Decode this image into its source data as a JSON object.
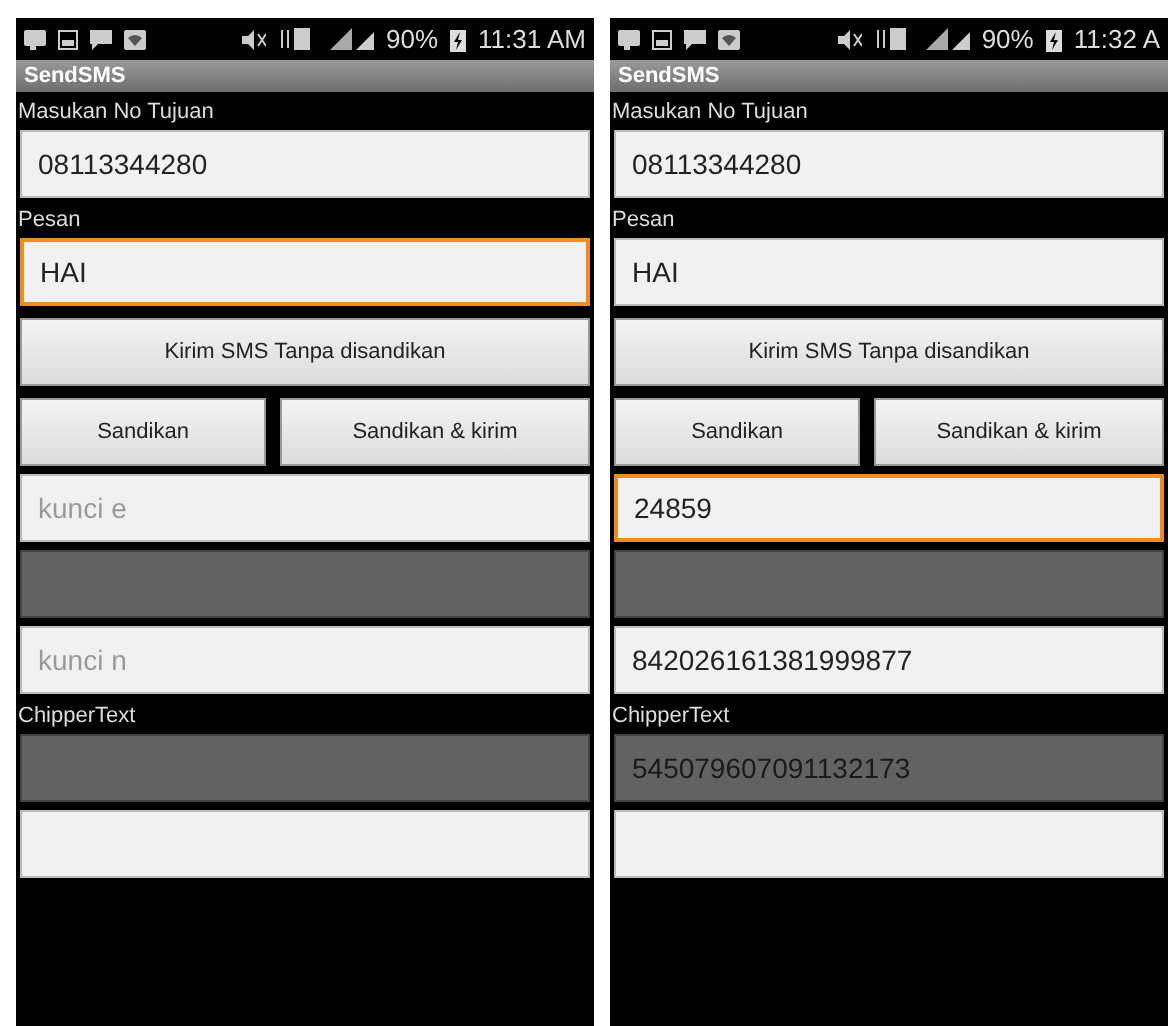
{
  "screens": [
    {
      "status": {
        "battery": "90%",
        "time": "11:31 AM"
      },
      "title": "SendSMS",
      "items": [
        {
          "kind": "label",
          "text": "Masukan No Tujuan"
        },
        {
          "kind": "field",
          "value": "08113344280",
          "focused": false,
          "disabled": false
        },
        {
          "kind": "label",
          "text": "Pesan"
        },
        {
          "kind": "field",
          "value": "HAI",
          "focused": true,
          "disabled": false
        },
        {
          "kind": "button",
          "label": "Kirim SMS Tanpa disandikan"
        },
        {
          "kind": "button_row",
          "buttons": [
            "Sandikan",
            "Sandikan & kirim"
          ]
        },
        {
          "kind": "field",
          "placeholder": "kunci e",
          "focused": false,
          "disabled": false
        },
        {
          "kind": "field",
          "focused": false,
          "disabled": true
        },
        {
          "kind": "field",
          "placeholder": "kunci n",
          "focused": false,
          "disabled": false
        },
        {
          "kind": "label",
          "text": "ChipperText"
        },
        {
          "kind": "field",
          "focused": false,
          "disabled": true
        },
        {
          "kind": "field",
          "focused": false,
          "disabled": false
        }
      ]
    },
    {
      "status": {
        "battery": "90%",
        "time": "11:32 A"
      },
      "title": "SendSMS",
      "items": [
        {
          "kind": "label",
          "text": "Masukan No Tujuan"
        },
        {
          "kind": "field",
          "value": "08113344280",
          "focused": false,
          "disabled": false
        },
        {
          "kind": "label",
          "text": "Pesan"
        },
        {
          "kind": "field",
          "value": "HAI",
          "focused": false,
          "disabled": false
        },
        {
          "kind": "button",
          "label": "Kirim SMS Tanpa disandikan"
        },
        {
          "kind": "button_row",
          "buttons": [
            "Sandikan",
            "Sandikan & kirim"
          ]
        },
        {
          "kind": "field",
          "value": "24859",
          "focused": true,
          "disabled": false
        },
        {
          "kind": "field",
          "focused": false,
          "disabled": true
        },
        {
          "kind": "field",
          "value": "842026161381999877",
          "focused": false,
          "disabled": false
        },
        {
          "kind": "label",
          "text": "ChipperText"
        },
        {
          "kind": "field",
          "value": "545079607091132173",
          "focused": false,
          "disabled": true
        },
        {
          "kind": "field",
          "focused": false,
          "disabled": false
        }
      ]
    }
  ]
}
